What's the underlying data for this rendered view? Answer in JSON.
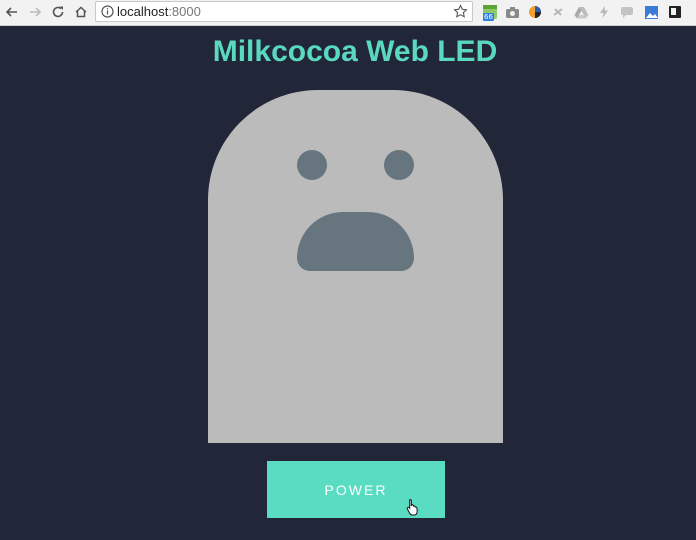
{
  "browser": {
    "url_host": "localhost",
    "url_port": ":8000",
    "extension_badge": "66"
  },
  "page": {
    "title": "Milkcocoa Web LED",
    "power_button_label": "POWER"
  },
  "colors": {
    "background": "#222639",
    "accent": "#5ad9c1",
    "ghost_body": "#bbbbbb",
    "ghost_features": "#66757e"
  },
  "icons": [
    "back-arrow-icon",
    "forward-arrow-icon",
    "reload-icon",
    "home-icon",
    "info-icon",
    "star-icon",
    "pointer-hand-cursor-icon"
  ]
}
